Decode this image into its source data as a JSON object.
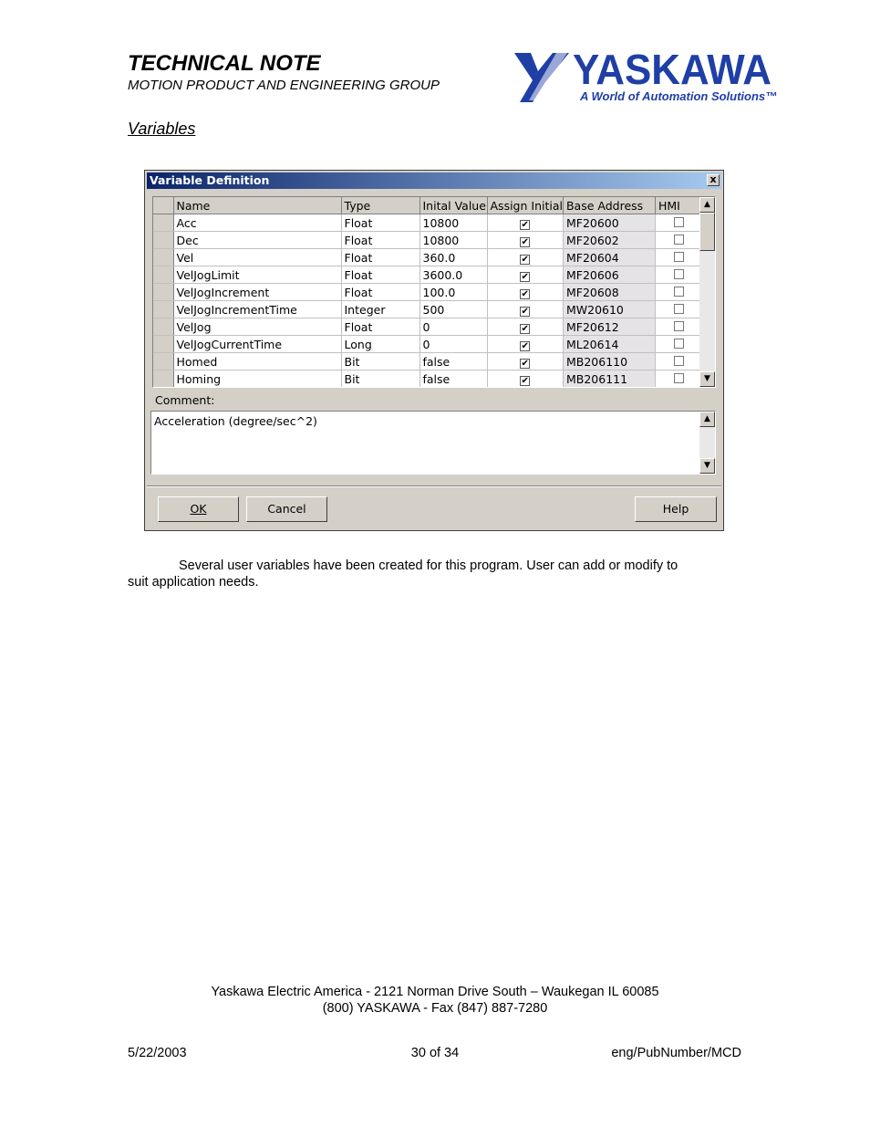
{
  "header": {
    "title": "TECHNICAL NOTE",
    "subtitle": "MOTION PRODUCT AND ENGINEERING GROUP",
    "logo_name": "YASKAWA",
    "logo_tagline": "A World of Automation Solutions™",
    "brand_color": "#1f3fa6"
  },
  "section_title": "Variables",
  "dialog": {
    "title": "Variable Definition",
    "close_label": "x",
    "columns": [
      "Name",
      "Type",
      "Inital Value",
      "Assign Initial",
      "Base Address",
      "HMI"
    ],
    "rows": [
      {
        "name": "Acc",
        "type": "Float",
        "initial": "10800",
        "assign": true,
        "address": "MF20600",
        "hmi": false
      },
      {
        "name": "Dec",
        "type": "Float",
        "initial": "10800",
        "assign": true,
        "address": "MF20602",
        "hmi": false
      },
      {
        "name": "Vel",
        "type": "Float",
        "initial": "360.0",
        "assign": true,
        "address": "MF20604",
        "hmi": false
      },
      {
        "name": "VelJogLimit",
        "type": "Float",
        "initial": "3600.0",
        "assign": true,
        "address": "MF20606",
        "hmi": false
      },
      {
        "name": "VelJogIncrement",
        "type": "Float",
        "initial": "100.0",
        "assign": true,
        "address": "MF20608",
        "hmi": false
      },
      {
        "name": "VelJogIncrementTime",
        "type": "Integer",
        "initial": "500",
        "assign": true,
        "address": "MW20610",
        "hmi": false
      },
      {
        "name": "VelJog",
        "type": "Float",
        "initial": "0",
        "assign": true,
        "address": "MF20612",
        "hmi": false
      },
      {
        "name": "VelJogCurrentTime",
        "type": "Long",
        "initial": "0",
        "assign": true,
        "address": "ML20614",
        "hmi": false
      },
      {
        "name": "Homed",
        "type": "Bit",
        "initial": "false",
        "assign": true,
        "address": "MB206110",
        "hmi": false
      },
      {
        "name": "Homing",
        "type": "Bit",
        "initial": "false",
        "assign": true,
        "address": "MB206111",
        "hmi": false
      }
    ],
    "comment_label": "Comment:",
    "comment_value": "Acceleration (degree/sec^2)",
    "buttons": {
      "ok": "OK",
      "cancel": "Cancel",
      "help": "Help"
    }
  },
  "paragraph": {
    "line1": "Several user variables have been created for this program.  User can add or modify to",
    "line2": "suit application needs."
  },
  "footer": {
    "address": "Yaskawa Electric America - 2121 Norman Drive South – Waukegan IL 60085",
    "phone": "(800) YASKAWA  - Fax (847) 887-7280",
    "date": "5/22/2003",
    "page": "30 of 34",
    "doc_id": "eng/PubNumber/MCD"
  }
}
